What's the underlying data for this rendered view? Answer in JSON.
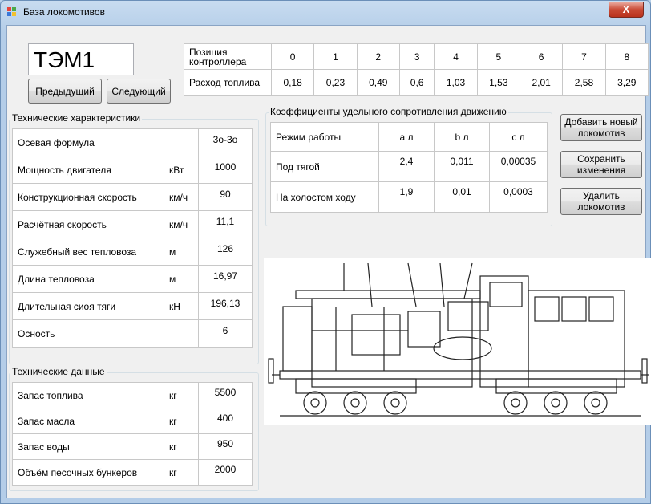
{
  "window": {
    "title": "База локомотивов",
    "close_symbol": "X"
  },
  "locomotive": {
    "name": "ТЭМ1"
  },
  "nav": {
    "prev_label": "Предыдущий",
    "next_label": "Следующий"
  },
  "fuel_table": {
    "row1_header": "Позиция контроллера",
    "row2_header": "Расход топлива",
    "positions": [
      "0",
      "1",
      "2",
      "3",
      "4",
      "5",
      "6",
      "7",
      "8"
    ],
    "consumption": [
      "0,18",
      "0,23",
      "0,49",
      "0,6",
      "1,03",
      "1,53",
      "2,01",
      "2,58",
      "3,29"
    ]
  },
  "tech_specs": {
    "title": "Технические характеристики",
    "rows": [
      {
        "label": "Осевая формула",
        "unit": "",
        "value": "3о-3о"
      },
      {
        "label": "Мощность двигателя",
        "unit": "кВт",
        "value": "1000"
      },
      {
        "label": "Конструкционная скорость",
        "unit": "км/ч",
        "value": "90"
      },
      {
        "label": "Расчётная скорость",
        "unit": "км/ч",
        "value": "11,1"
      },
      {
        "label": "Служебный вес тепловоза",
        "unit": "м",
        "value": "126"
      },
      {
        "label": "Длина тепловоза",
        "unit": "м",
        "value": "16,97"
      },
      {
        "label": "Длительная сиоя тяги",
        "unit": "кН",
        "value": "196,13"
      },
      {
        "label": "Осность",
        "unit": "",
        "value": "6"
      }
    ]
  },
  "tech_data": {
    "title": "Технические данные",
    "rows": [
      {
        "label": "Запас топлива",
        "unit": "кг",
        "value": "5500"
      },
      {
        "label": "Запас масла",
        "unit": "кг",
        "value": "400"
      },
      {
        "label": "Запас воды",
        "unit": "кг",
        "value": "950"
      },
      {
        "label": "Объём песочных бункеров",
        "unit": "кг",
        "value": "2000"
      }
    ]
  },
  "resistance": {
    "title": "Коэффициенты удельного сопротивления движению",
    "headers": [
      "Режим работы",
      "а л",
      "b л",
      "с л"
    ],
    "rows": [
      [
        "Под тягой",
        "2,4",
        "0,011",
        "0,00035"
      ],
      [
        "На холостом ходу",
        "1,9",
        "0,01",
        "0,0003"
      ]
    ]
  },
  "actions": {
    "add_label": "Добавить новый локомотив",
    "save_label": "Сохранить изменения",
    "delete_label": "Удалить локомотив"
  },
  "colors": {
    "close": "#c94a35",
    "background": "#f0f0f0"
  }
}
